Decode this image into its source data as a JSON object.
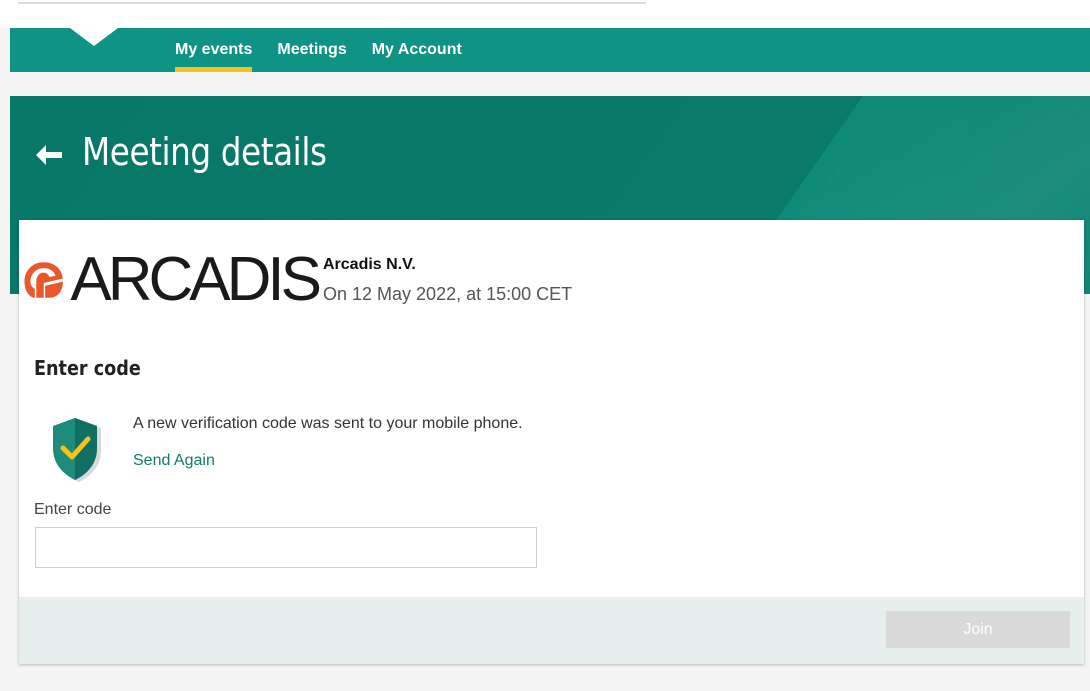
{
  "nav": {
    "items": [
      {
        "label": "My events",
        "active": true
      },
      {
        "label": "Meetings",
        "active": false
      },
      {
        "label": "My Account",
        "active": false
      }
    ]
  },
  "hero": {
    "title": "Meeting details",
    "back_icon": "arrow-left-icon"
  },
  "company": {
    "logo_text": "ARCADIS",
    "name": "Arcadis N.V.",
    "date": "On 12 May 2022, at 15:00 CET"
  },
  "verification": {
    "section_title": "Enter code",
    "message": "A new verification code was sent to your mobile phone.",
    "send_again": "Send Again",
    "shield_icon": "shield-check-icon",
    "code_label": "Enter code",
    "code_value": "",
    "code_placeholder": ""
  },
  "footer": {
    "join_label": "Join"
  },
  "colors": {
    "nav_bg": "#0e9384",
    "hero_bg": "#077868",
    "accent_yellow": "#f6c21b",
    "link": "#127b6e",
    "logo_orange": "#e8582a",
    "disabled_button": "#d9d9d9"
  }
}
